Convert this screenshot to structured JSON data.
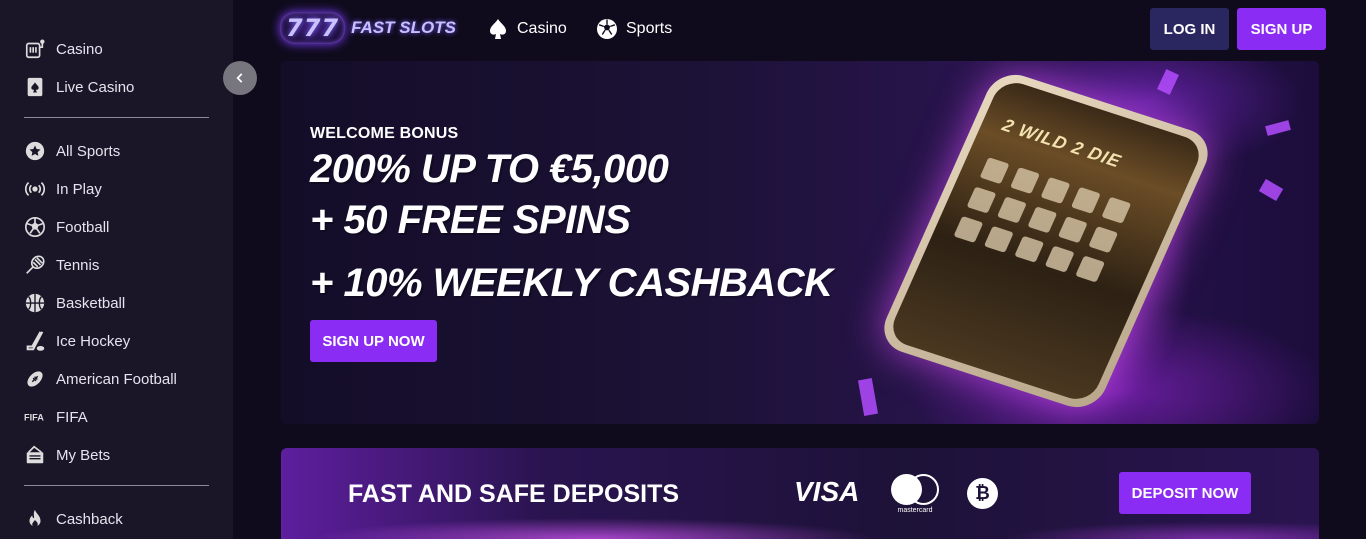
{
  "brand": {
    "logo_number": "777",
    "logo_name": "FAST SLOTS"
  },
  "header": {
    "nav": [
      {
        "label": "Casino",
        "icon": "spade-icon"
      },
      {
        "label": "Sports",
        "icon": "soccer-ball-icon"
      }
    ],
    "login_label": "LOG IN",
    "signup_label": "SIGN UP"
  },
  "sidebar": {
    "groups": [
      [
        {
          "label": "Casino",
          "icon": "slot-machine-icon"
        },
        {
          "label": "Live Casino",
          "icon": "playing-card-icon"
        }
      ],
      [
        {
          "label": "All Sports",
          "icon": "star-ball-icon"
        },
        {
          "label": "In Play",
          "icon": "broadcast-icon"
        },
        {
          "label": "Football",
          "icon": "soccer-ball-icon"
        },
        {
          "label": "Tennis",
          "icon": "tennis-racket-icon"
        },
        {
          "label": "Basketball",
          "icon": "basketball-icon"
        },
        {
          "label": "Ice Hockey",
          "icon": "hockey-stick-icon"
        },
        {
          "label": "American Football",
          "icon": "american-football-icon"
        },
        {
          "label": "FIFA",
          "icon": "fifa-icon"
        },
        {
          "label": "My Bets",
          "icon": "tickets-icon"
        }
      ],
      [
        {
          "label": "Cashback",
          "icon": "flame-icon"
        }
      ]
    ]
  },
  "hero": {
    "kicker": "WELCOME BONUS",
    "line1": "200% UP TO €5,000",
    "line2": "+ 50 FREE SPINS",
    "line3": "+ 10% WEEKLY CASHBACK",
    "cta_label": "SIGN UP NOW",
    "game_title": "2 WILD 2 DIE"
  },
  "deposit": {
    "title": "FAST AND SAFE DEPOSITS",
    "visa_label": "VISA",
    "mastercard_label": "mastercard",
    "bitcoin_symbol": "₿",
    "cta_label": "DEPOSIT NOW"
  },
  "colors": {
    "accent": "#8b2cf5",
    "login_bg": "#2a2660",
    "sidebar_bg": "#1a1628",
    "page_bg": "#0f0b1c"
  }
}
